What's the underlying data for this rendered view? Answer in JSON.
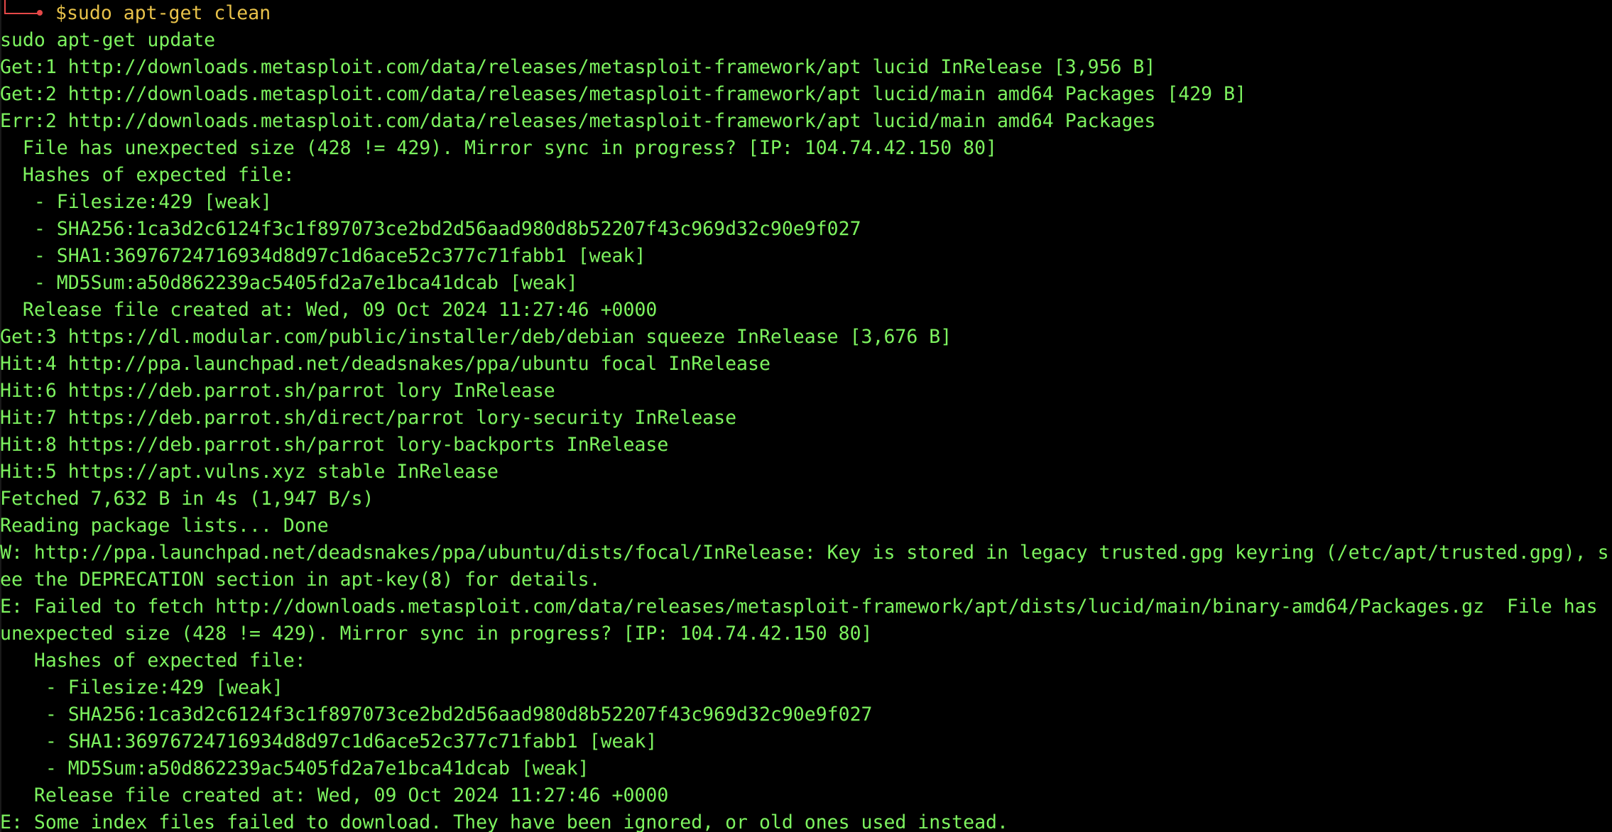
{
  "colors": {
    "background": "#000000",
    "output_text": "#7df35f",
    "prompt_text": "#e8c24a",
    "prompt_frame": "#e64848"
  },
  "prompt": {
    "symbol": "$",
    "command": "sudo apt-get clean"
  },
  "output_lines": [
    "sudo apt-get update",
    "Get:1 http://downloads.metasploit.com/data/releases/metasploit-framework/apt lucid InRelease [3,956 B]",
    "Get:2 http://downloads.metasploit.com/data/releases/metasploit-framework/apt lucid/main amd64 Packages [429 B]",
    "Err:2 http://downloads.metasploit.com/data/releases/metasploit-framework/apt lucid/main amd64 Packages",
    "  File has unexpected size (428 != 429). Mirror sync in progress? [IP: 104.74.42.150 80]",
    "  Hashes of expected file:",
    "   - Filesize:429 [weak]",
    "   - SHA256:1ca3d2c6124f3c1f897073ce2bd2d56aad980d8b52207f43c969d32c90e9f027",
    "   - SHA1:36976724716934d8d97c1d6ace52c377c71fabb1 [weak]",
    "   - MD5Sum:a50d862239ac5405fd2a7e1bca41dcab [weak]",
    "  Release file created at: Wed, 09 Oct 2024 11:27:46 +0000",
    "Get:3 https://dl.modular.com/public/installer/deb/debian squeeze InRelease [3,676 B]",
    "Hit:4 http://ppa.launchpad.net/deadsnakes/ppa/ubuntu focal InRelease",
    "Hit:6 https://deb.parrot.sh/parrot lory InRelease",
    "Hit:7 https://deb.parrot.sh/direct/parrot lory-security InRelease",
    "Hit:8 https://deb.parrot.sh/parrot lory-backports InRelease",
    "Hit:5 https://apt.vulns.xyz stable InRelease",
    "Fetched 7,632 B in 4s (1,947 B/s)",
    "Reading package lists... Done",
    "W: http://ppa.launchpad.net/deadsnakes/ppa/ubuntu/dists/focal/InRelease: Key is stored in legacy trusted.gpg keyring (/etc/apt/trusted.gpg), s",
    "ee the DEPRECATION section in apt-key(8) for details.",
    "E: Failed to fetch http://downloads.metasploit.com/data/releases/metasploit-framework/apt/dists/lucid/main/binary-amd64/Packages.gz  File has",
    "unexpected size (428 != 429). Mirror sync in progress? [IP: 104.74.42.150 80]",
    "   Hashes of expected file:",
    "    - Filesize:429 [weak]",
    "    - SHA256:1ca3d2c6124f3c1f897073ce2bd2d56aad980d8b52207f43c969d32c90e9f027",
    "    - SHA1:36976724716934d8d97c1d6ace52c377c71fabb1 [weak]",
    "    - MD5Sum:a50d862239ac5405fd2a7e1bca41dcab [weak]",
    "   Release file created at: Wed, 09 Oct 2024 11:27:46 +0000",
    "E: Some index files failed to download. They have been ignored, or old ones used instead."
  ]
}
